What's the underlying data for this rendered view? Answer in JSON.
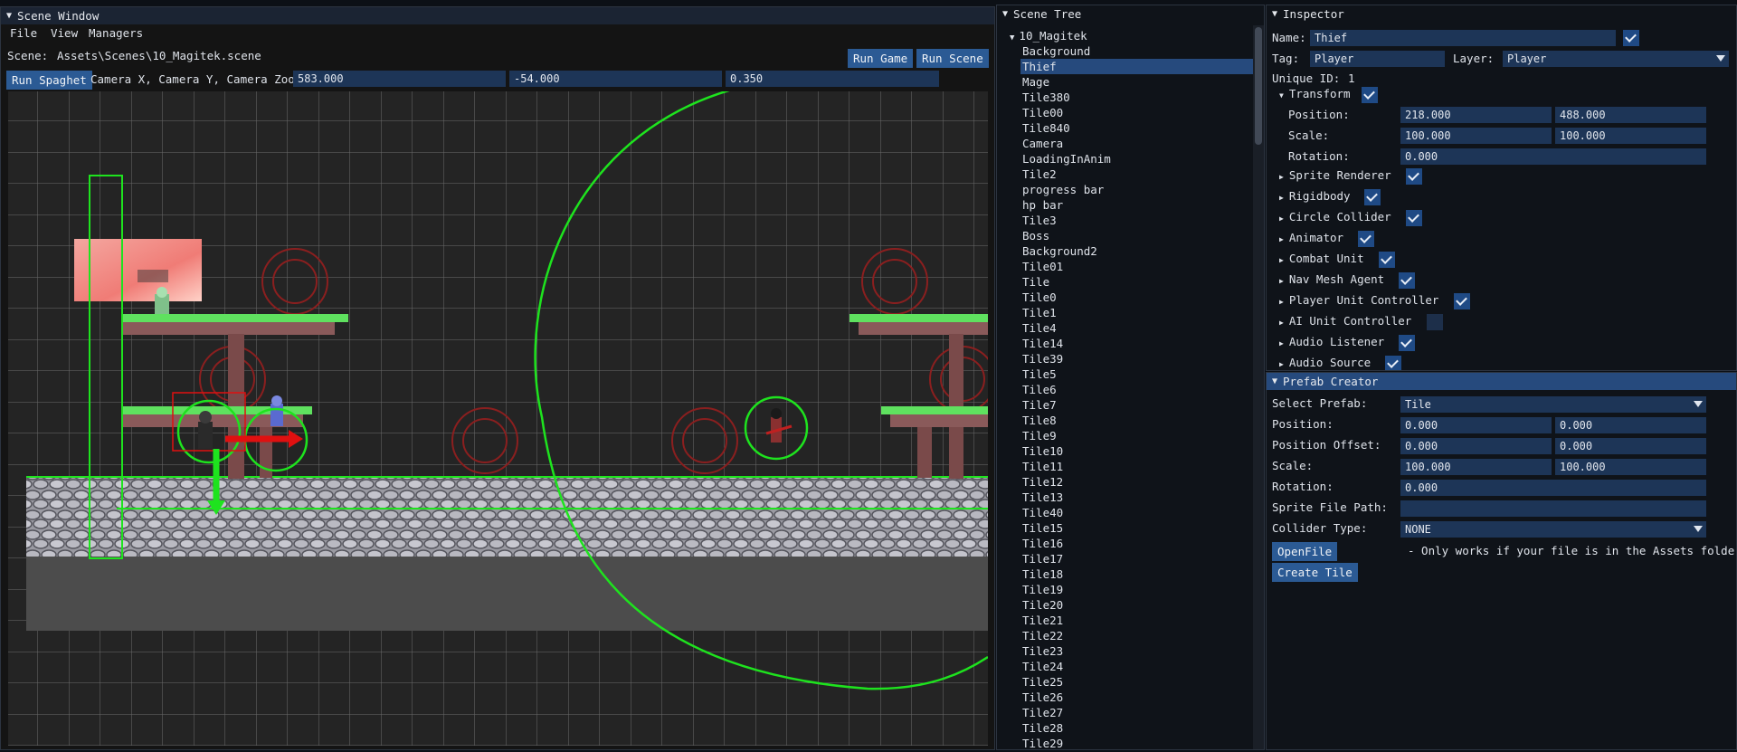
{
  "scene_window": {
    "title": "Scene Window",
    "menu": [
      "File",
      "View",
      "Managers"
    ],
    "scene_label": "Scene:",
    "scene_path": "Assets\\Scenes\\10_Magitek.scene",
    "run_game": "Run Game",
    "run_scene": "Run Scene",
    "run_spaghet": "Run Spaghet",
    "camera_label": "Camera X, Camera Y, Camera Zoom",
    "camera_x": "583.000",
    "camera_y": "-54.000",
    "camera_zoom": "0.350"
  },
  "scene_tree": {
    "title": "Scene Tree",
    "root": "10_Magitek",
    "selected": "Thief",
    "items": [
      "Background",
      "Thief",
      "Mage",
      "Tile380",
      "Tile00",
      "Tile840",
      "Camera",
      "LoadingInAnim",
      "Tile2",
      "progress bar",
      "hp bar",
      "Tile3",
      "Boss",
      "Background2",
      "Tile01",
      "Tile",
      "Tile0",
      "Tile1",
      "Tile4",
      "Tile14",
      "Tile39",
      "Tile5",
      "Tile6",
      "Tile7",
      "Tile8",
      "Tile9",
      "Tile10",
      "Tile11",
      "Tile12",
      "Tile13",
      "Tile40",
      "Tile15",
      "Tile16",
      "Tile17",
      "Tile18",
      "Tile19",
      "Tile20",
      "Tile21",
      "Tile22",
      "Tile23",
      "Tile24",
      "Tile25",
      "Tile26",
      "Tile27",
      "Tile28",
      "Tile29"
    ]
  },
  "inspector": {
    "title": "Inspector",
    "name_label": "Name:",
    "name_value": "Thief",
    "tag_label": "Tag:",
    "tag_value": "Player",
    "layer_label": "Layer:",
    "layer_value": "Player",
    "uid_label": "Unique ID:",
    "uid_value": "1",
    "transform": {
      "label": "Transform",
      "position_label": "Position:",
      "pos_x": "218.000",
      "pos_y": "488.000",
      "scale_label": "Scale:",
      "scale_x": "100.000",
      "scale_y": "100.000",
      "rotation_label": "Rotation:",
      "rotation": "0.000"
    },
    "components": [
      {
        "label": "Sprite Renderer",
        "checked": true
      },
      {
        "label": "Rigidbody",
        "checked": true
      },
      {
        "label": "Circle Collider",
        "checked": true
      },
      {
        "label": "Animator",
        "checked": true
      },
      {
        "label": "Combat Unit",
        "checked": true
      },
      {
        "label": "Nav Mesh Agent",
        "checked": true
      },
      {
        "label": "Player Unit Controller",
        "checked": true
      },
      {
        "label": "AI Unit Controller",
        "checked": false
      },
      {
        "label": "Audio Listener",
        "checked": true
      },
      {
        "label": "Audio Source",
        "checked": true
      }
    ]
  },
  "prefab": {
    "title": "Prefab Creator",
    "select_label": "Select Prefab:",
    "select_value": "Tile",
    "position_label": "Position:",
    "pos_x": "0.000",
    "pos_y": "0.000",
    "offset_label": "Position Offset:",
    "off_x": "0.000",
    "off_y": "0.000",
    "scale_label": "Scale:",
    "scale_x": "100.000",
    "scale_y": "100.000",
    "rotation_label": "Rotation:",
    "rotation": "0.000",
    "sprite_label": "Sprite File Path:",
    "sprite_value": "",
    "collider_label": "Collider Type:",
    "collider_value": "NONE",
    "openfile": "OpenFile",
    "openfile_note": "- Only works if your file is in the Assets folder! -",
    "create_tile": "Create Tile"
  },
  "colors": {
    "panel_bg": "#0f1319",
    "title_bg": "#1b2433",
    "button": "#2b5a94",
    "field": "#1d3557",
    "collider_green": "#1ee31e",
    "selection_red": "#e01010"
  }
}
